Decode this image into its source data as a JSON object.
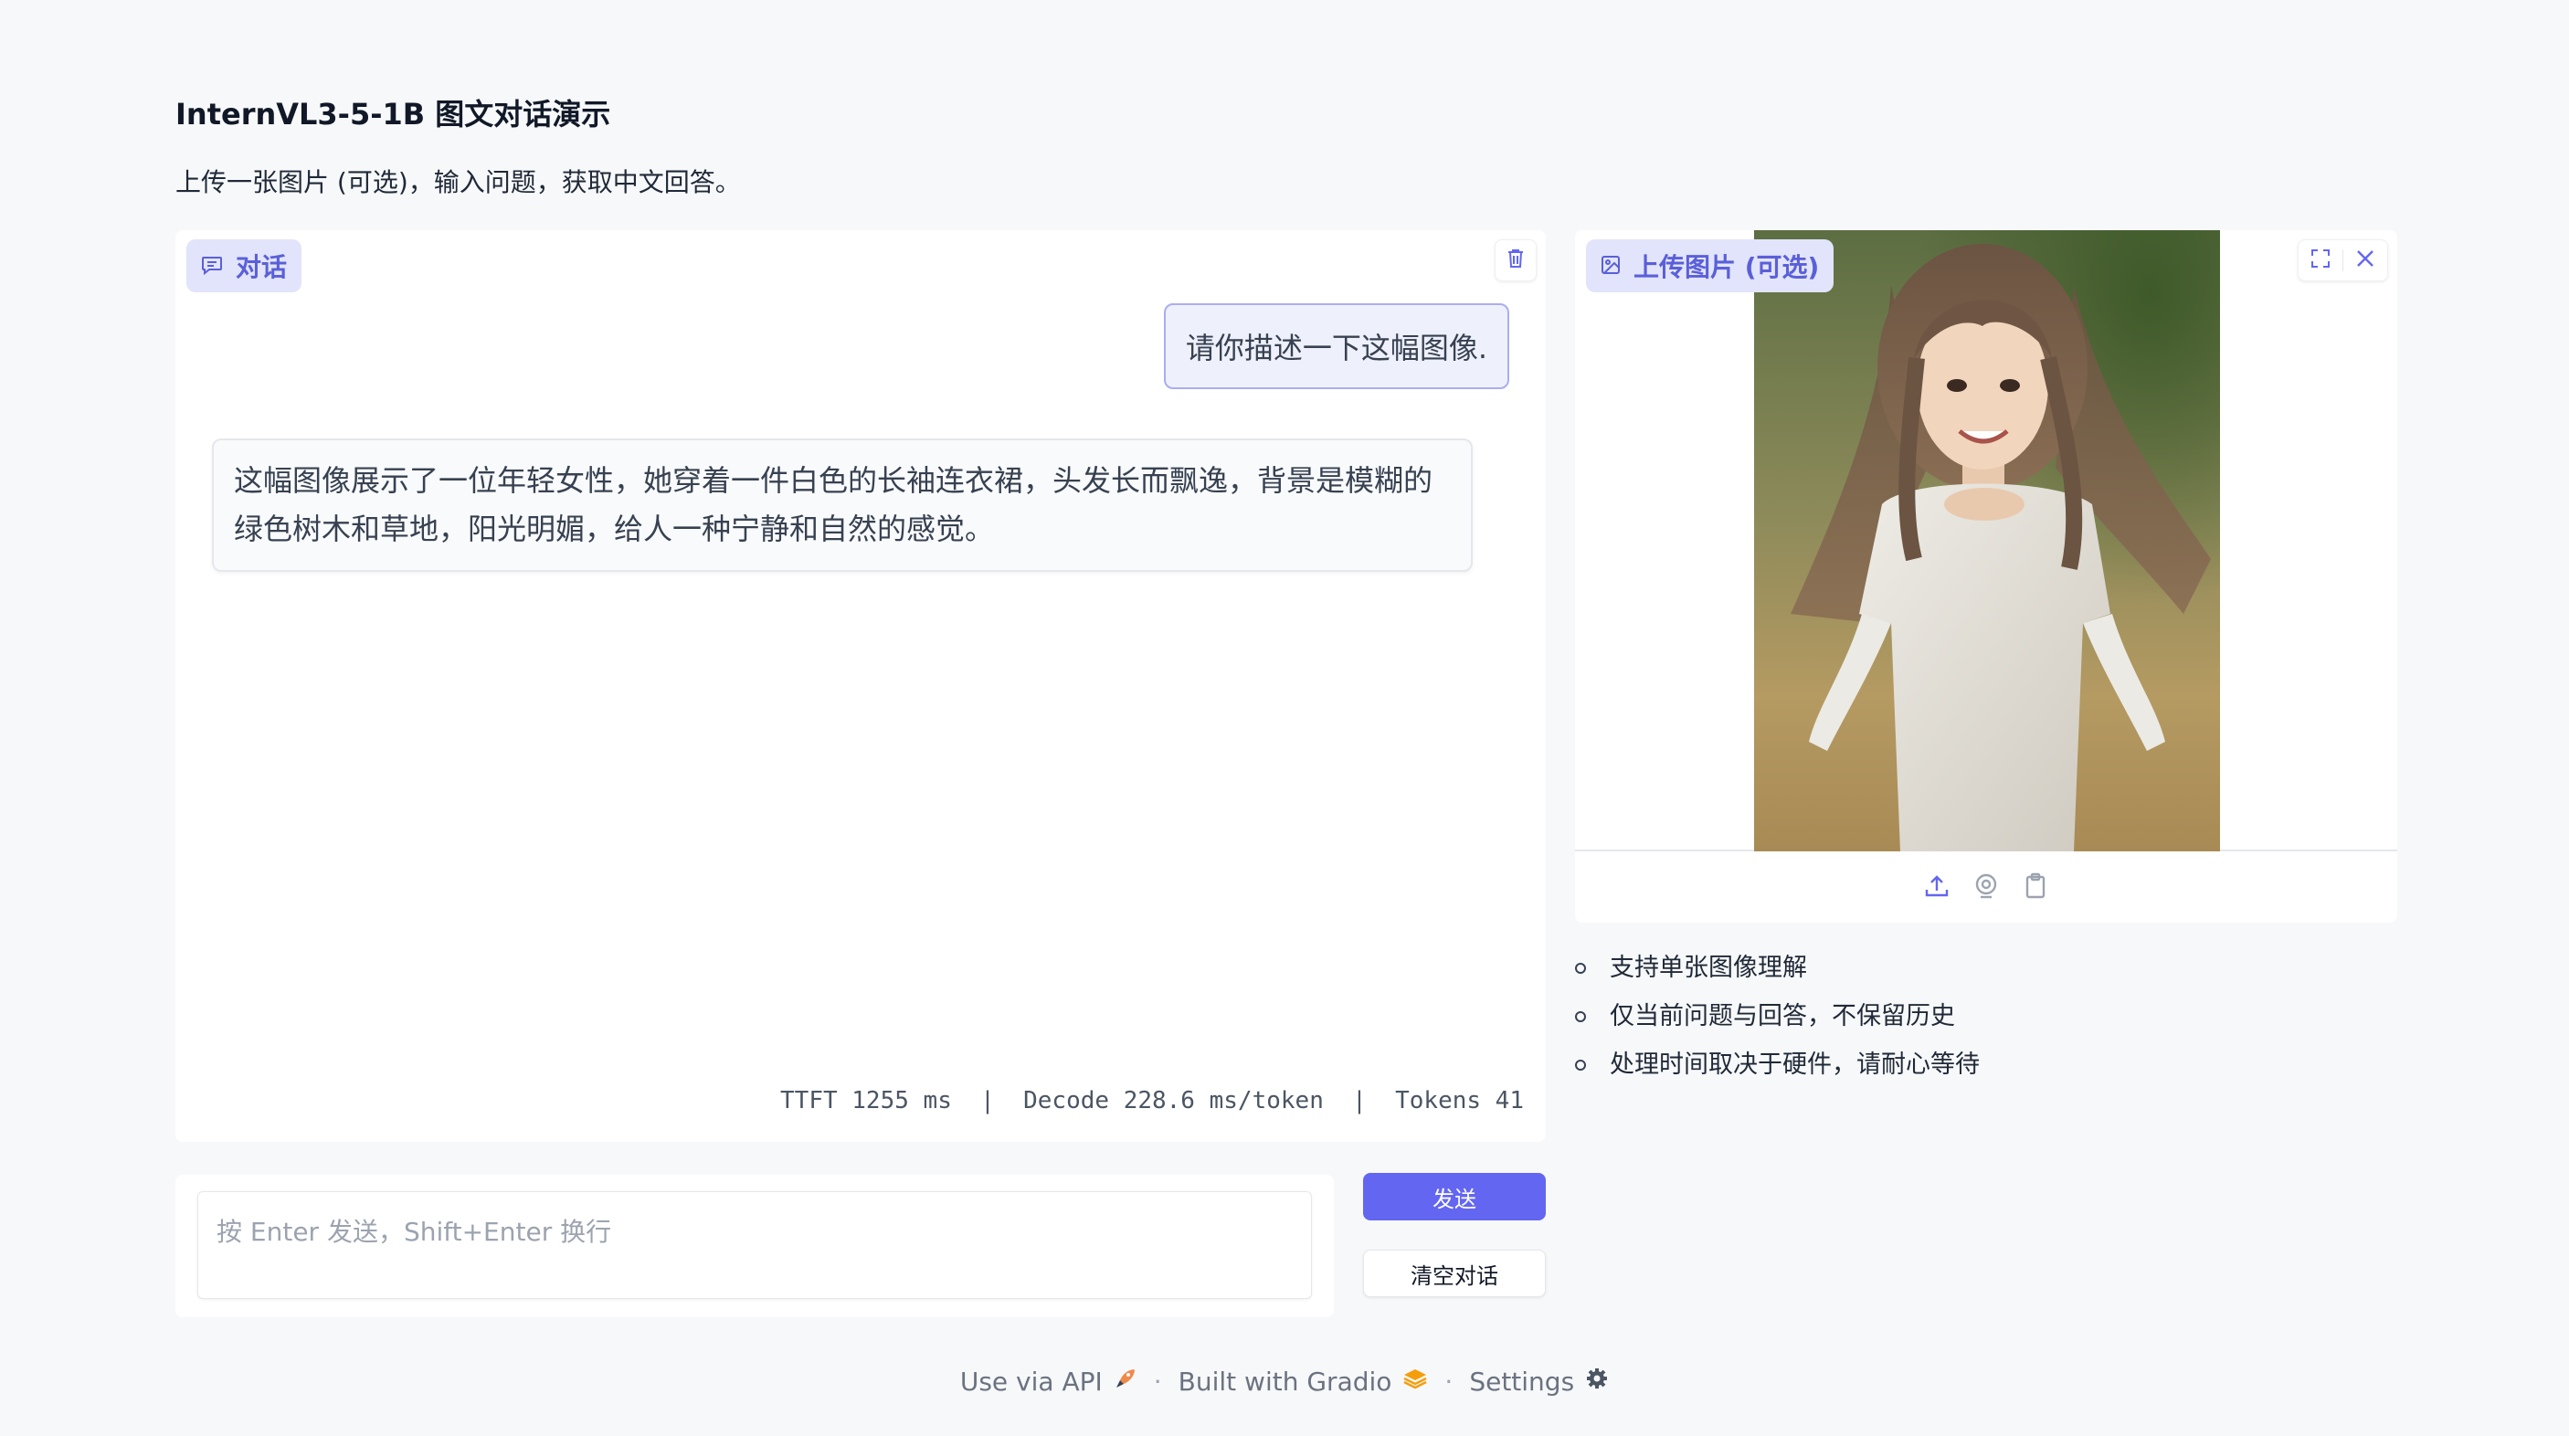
{
  "header": {
    "title": "InternVL3-5-1B 图文对话演示",
    "subtitle": "上传一张图片 (可选)，输入问题，获取中文回答。"
  },
  "chat": {
    "label": "对话",
    "label_icon": "chat-icon",
    "clear_icon": "trash-icon",
    "messages": [
      {
        "role": "user",
        "text": "请你描述一下这幅图像."
      },
      {
        "role": "assistant",
        "text": "这幅图像展示了一位年轻女性，她穿着一件白色的长袖连衣裙，头发长而飘逸，背景是模糊的绿色树木和草地，阳光明媚，给人一种宁静和自然的感觉。"
      }
    ],
    "stats": "TTFT 1255 ms  |  Decode 228.6 ms/token  |  Tokens 41"
  },
  "input": {
    "placeholder": "按 Enter 发送，Shift+Enter 换行",
    "value": ""
  },
  "buttons": {
    "send": "发送",
    "clear": "清空对话"
  },
  "image_upload": {
    "label": "上传图片 (可选)",
    "label_icon": "image-icon",
    "tools": [
      "fullscreen-icon",
      "close-icon"
    ],
    "sources": [
      "upload-icon",
      "webcam-icon",
      "clipboard-icon"
    ]
  },
  "notes": [
    "支持单张图像理解",
    "仅当前问题与回答，不保留历史",
    "处理时间取决于硬件，请耐心等待"
  ],
  "footer": {
    "api": "Use via API",
    "built": "Built with Gradio",
    "settings": "Settings"
  },
  "colors": {
    "accent": "#6366f1",
    "label_bg": "#e2e4fb",
    "label_text": "#5a5fd9",
    "page_bg": "#f7f8fa"
  }
}
